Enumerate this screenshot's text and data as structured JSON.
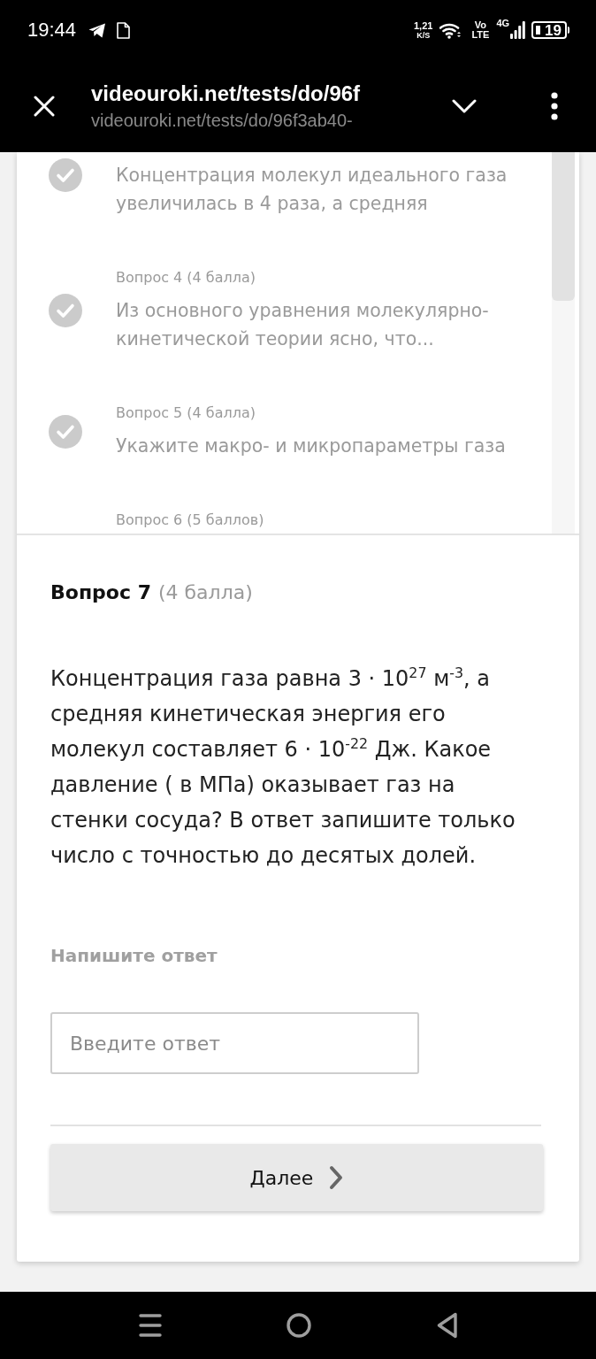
{
  "status_bar": {
    "time": "19:44",
    "net_speed": "1,21",
    "net_speed_unit": "K/S",
    "volte_top": "Vo",
    "volte_bottom": "LTE",
    "network": "4G",
    "battery": "19"
  },
  "browser_bar": {
    "title": "videouroki.net/tests/do/96f",
    "url": "videouroki.net/tests/do/96f3ab40-"
  },
  "question_list": {
    "items": [
      {
        "text": "Концентрация молекул идеального газа увеличилась в 4 раза, а средняя",
        "answered": true
      },
      {
        "label": "Вопрос 4 (4 балла)",
        "text": "Из основного уравнения молекулярно-кинетической теории ясно, что...",
        "answered": true
      },
      {
        "label": "Вопрос 5 (4 балла)",
        "text": "Укажите макро- и микропараметры газа",
        "answered": true
      }
    ],
    "clipped_label": "Вопрос 6 (5 баллов)"
  },
  "question": {
    "number": "Вопрос 7",
    "points": "(4 балла)",
    "text": "Концентрация газа равна 3 · 10$^{27}$ м$^{-3}$, а средняя кинетическая энергия его молекул составляет 6 · 10$^{-22}$ Дж. Какое давление ( в МПа) оказывает газ на стенки сосуда? В ответ запишите только число с точностью до десятых долей.",
    "answer_label": "Напишите ответ",
    "answer": {
      "placeholder": "Введите ответ"
    },
    "next_button": "Далее"
  }
}
